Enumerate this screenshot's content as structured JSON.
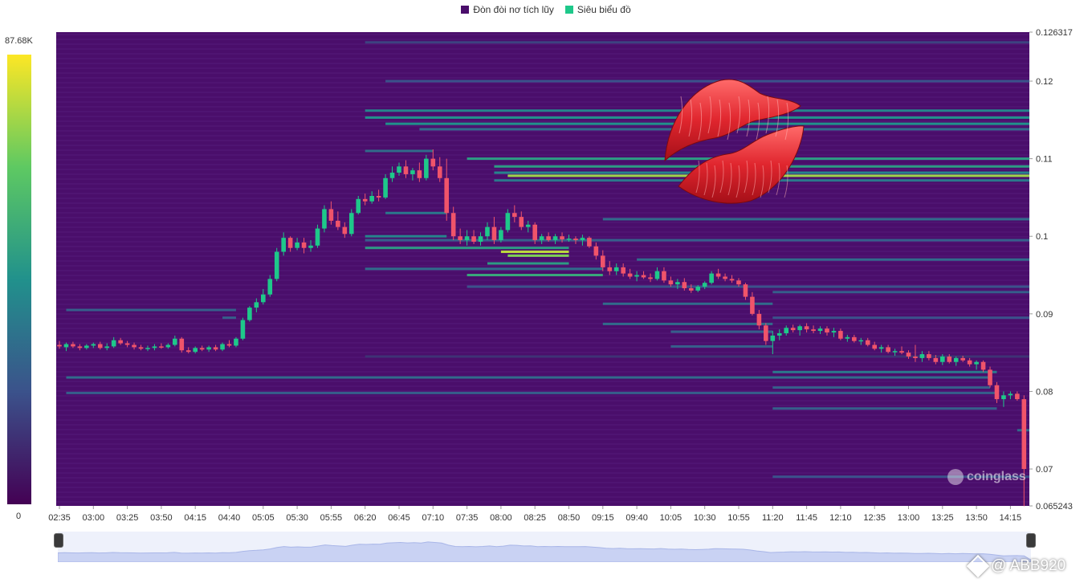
{
  "legend": [
    {
      "label": "Đòn đòi nơ tích lũy",
      "color": "#4a0e6b"
    },
    {
      "label": "Siêu biểu đồ",
      "color": "#1ec88a"
    }
  ],
  "colorbar": {
    "max_label": "87.68K",
    "min_label": "0"
  },
  "chart_data": {
    "type": "heatmap",
    "title": "",
    "xlabel": "",
    "ylabel": "",
    "ylim": [
      0.065243,
      0.126317
    ],
    "y_ticks": [
      "0.126317",
      "0.12",
      "0.11",
      "0.1",
      "0.09",
      "0.08",
      "0.07",
      "0.065243"
    ],
    "x_ticks": [
      "02:35",
      "03:00",
      "03:25",
      "03:50",
      "04:15",
      "04:40",
      "05:05",
      "05:30",
      "05:55",
      "06:20",
      "06:45",
      "07:10",
      "07:35",
      "08:00",
      "08:25",
      "08:50",
      "09:15",
      "09:40",
      "10:05",
      "10:30",
      "10:55",
      "11:20",
      "11:45",
      "12:10",
      "12:35",
      "13:00",
      "13:25",
      "13:50",
      "14:15"
    ],
    "x_start_minutes": 155,
    "x_step_minutes": 5,
    "colorscale": {
      "min": 0,
      "max": 87680
    },
    "heat_bands": [
      {
        "price": 0.1162,
        "start": "06:20",
        "end": "14:35",
        "intensity": 0.45
      },
      {
        "price": 0.1153,
        "start": "06:20",
        "end": "14:35",
        "intensity": 0.5
      },
      {
        "price": 0.1145,
        "start": "06:35",
        "end": "14:35",
        "intensity": 0.5
      },
      {
        "price": 0.1138,
        "start": "07:00",
        "end": "14:35",
        "intensity": 0.35
      },
      {
        "price": 0.111,
        "start": "06:20",
        "end": "07:10",
        "intensity": 0.35
      },
      {
        "price": 0.11,
        "start": "07:35",
        "end": "14:35",
        "intensity": 0.55
      },
      {
        "price": 0.109,
        "start": "07:55",
        "end": "14:35",
        "intensity": 0.55
      },
      {
        "price": 0.1082,
        "start": "07:55",
        "end": "14:35",
        "intensity": 0.45
      },
      {
        "price": 0.1078,
        "start": "08:05",
        "end": "14:35",
        "intensity": 0.85
      },
      {
        "price": 0.1072,
        "start": "07:55",
        "end": "14:35",
        "intensity": 0.4
      },
      {
        "price": 0.12,
        "start": "06:35",
        "end": "14:35",
        "intensity": 0.25
      },
      {
        "price": 0.125,
        "start": "06:20",
        "end": "14:35",
        "intensity": 0.2
      },
      {
        "price": 0.103,
        "start": "06:35",
        "end": "07:20",
        "intensity": 0.4
      },
      {
        "price": 0.1022,
        "start": "09:15",
        "end": "14:35",
        "intensity": 0.35
      },
      {
        "price": 0.1,
        "start": "06:20",
        "end": "07:20",
        "intensity": 0.45
      },
      {
        "price": 0.0995,
        "start": "06:20",
        "end": "14:35",
        "intensity": 0.3
      },
      {
        "price": 0.0985,
        "start": "06:20",
        "end": "08:50",
        "intensity": 0.55
      },
      {
        "price": 0.098,
        "start": "08:00",
        "end": "08:50",
        "intensity": 0.9
      },
      {
        "price": 0.0975,
        "start": "08:05",
        "end": "08:50",
        "intensity": 0.8
      },
      {
        "price": 0.097,
        "start": "09:40",
        "end": "14:35",
        "intensity": 0.35
      },
      {
        "price": 0.0965,
        "start": "07:50",
        "end": "08:50",
        "intensity": 0.55
      },
      {
        "price": 0.0958,
        "start": "06:20",
        "end": "09:15",
        "intensity": 0.35
      },
      {
        "price": 0.095,
        "start": "07:35",
        "end": "09:15",
        "intensity": 0.6
      },
      {
        "price": 0.0935,
        "start": "07:35",
        "end": "14:35",
        "intensity": 0.25
      },
      {
        "price": 0.0928,
        "start": "11:20",
        "end": "14:35",
        "intensity": 0.3
      },
      {
        "price": 0.0913,
        "start": "09:15",
        "end": "11:20",
        "intensity": 0.35
      },
      {
        "price": 0.0905,
        "start": "02:40",
        "end": "04:45",
        "intensity": 0.3
      },
      {
        "price": 0.0895,
        "start": "04:35",
        "end": "04:45",
        "intensity": 0.3
      },
      {
        "price": 0.0895,
        "start": "11:20",
        "end": "14:35",
        "intensity": 0.25
      },
      {
        "price": 0.0887,
        "start": "09:15",
        "end": "11:20",
        "intensity": 0.35
      },
      {
        "price": 0.0877,
        "start": "10:05",
        "end": "11:20",
        "intensity": 0.3
      },
      {
        "price": 0.0858,
        "start": "10:05",
        "end": "11:20",
        "intensity": 0.3
      },
      {
        "price": 0.0845,
        "start": "06:20",
        "end": "14:35",
        "intensity": 0.15
      },
      {
        "price": 0.0825,
        "start": "11:20",
        "end": "14:05",
        "intensity": 0.4
      },
      {
        "price": 0.0818,
        "start": "02:40",
        "end": "14:00",
        "intensity": 0.35
      },
      {
        "price": 0.0805,
        "start": "11:20",
        "end": "14:00",
        "intensity": 0.3
      },
      {
        "price": 0.0798,
        "start": "02:40",
        "end": "14:05",
        "intensity": 0.3
      },
      {
        "price": 0.0778,
        "start": "11:20",
        "end": "14:05",
        "intensity": 0.3
      },
      {
        "price": 0.075,
        "start": "14:20",
        "end": "14:35",
        "intensity": 0.35
      },
      {
        "price": 0.069,
        "start": "11:20",
        "end": "14:35",
        "intensity": 0.25
      }
    ],
    "candles": [
      [
        0.086,
        0.0865,
        0.0855,
        0.0858
      ],
      [
        0.0857,
        0.0863,
        0.0852,
        0.0861
      ],
      [
        0.0861,
        0.0864,
        0.0856,
        0.0858
      ],
      [
        0.0858,
        0.0861,
        0.0853,
        0.0856
      ],
      [
        0.0856,
        0.0861,
        0.0854,
        0.0859
      ],
      [
        0.0859,
        0.0863,
        0.0856,
        0.0861
      ],
      [
        0.0861,
        0.0864,
        0.0854,
        0.0856
      ],
      [
        0.0856,
        0.0862,
        0.0853,
        0.0858
      ],
      [
        0.0858,
        0.087,
        0.0856,
        0.0866
      ],
      [
        0.0866,
        0.0869,
        0.086,
        0.0862
      ],
      [
        0.0862,
        0.0865,
        0.0857,
        0.086
      ],
      [
        0.086,
        0.0863,
        0.0854,
        0.0857
      ],
      [
        0.0857,
        0.086,
        0.0853,
        0.0855
      ],
      [
        0.0855,
        0.0859,
        0.0852,
        0.0856
      ],
      [
        0.0856,
        0.0861,
        0.0853,
        0.0858
      ],
      [
        0.0858,
        0.0862,
        0.0855,
        0.0857
      ],
      [
        0.0857,
        0.0862,
        0.0855,
        0.086
      ],
      [
        0.086,
        0.0872,
        0.0858,
        0.0868
      ],
      [
        0.0868,
        0.087,
        0.085,
        0.0853
      ],
      [
        0.0853,
        0.0857,
        0.0849,
        0.0851
      ],
      [
        0.0851,
        0.0858,
        0.0849,
        0.0856
      ],
      [
        0.0856,
        0.0859,
        0.0852,
        0.0854
      ],
      [
        0.0854,
        0.0859,
        0.0851,
        0.0857
      ],
      [
        0.0857,
        0.086,
        0.0852,
        0.0854
      ],
      [
        0.0854,
        0.0863,
        0.0852,
        0.0861
      ],
      [
        0.0861,
        0.0866,
        0.0857,
        0.0859
      ],
      [
        0.0859,
        0.087,
        0.0857,
        0.0868
      ],
      [
        0.0868,
        0.0895,
        0.0866,
        0.0892
      ],
      [
        0.0892,
        0.091,
        0.089,
        0.0908
      ],
      [
        0.0908,
        0.092,
        0.0902,
        0.0915
      ],
      [
        0.0915,
        0.0932,
        0.0912,
        0.0925
      ],
      [
        0.0925,
        0.095,
        0.0922,
        0.0945
      ],
      [
        0.0945,
        0.0985,
        0.0942,
        0.098
      ],
      [
        0.098,
        0.1005,
        0.0975,
        0.0998
      ],
      [
        0.0998,
        0.1,
        0.098,
        0.0985
      ],
      [
        0.0985,
        0.0998,
        0.0982,
        0.0992
      ],
      [
        0.0992,
        0.0998,
        0.0978,
        0.0985
      ],
      [
        0.0985,
        0.0995,
        0.098,
        0.0988
      ],
      [
        0.0988,
        0.1015,
        0.0985,
        0.101
      ],
      [
        0.101,
        0.104,
        0.1005,
        0.1035
      ],
      [
        0.1035,
        0.1045,
        0.1015,
        0.102
      ],
      [
        0.102,
        0.1032,
        0.1008,
        0.1012
      ],
      [
        0.1012,
        0.1018,
        0.0998,
        0.1003
      ],
      [
        0.1003,
        0.1035,
        0.1,
        0.103
      ],
      [
        0.103,
        0.1052,
        0.1028,
        0.1048
      ],
      [
        0.1048,
        0.1055,
        0.104,
        0.1045
      ],
      [
        0.1045,
        0.1058,
        0.1042,
        0.1052
      ],
      [
        0.1052,
        0.106,
        0.1045,
        0.105
      ],
      [
        0.105,
        0.108,
        0.1048,
        0.1075
      ],
      [
        0.1075,
        0.109,
        0.107,
        0.1082
      ],
      [
        0.1082,
        0.1095,
        0.1078,
        0.109
      ],
      [
        0.109,
        0.1098,
        0.1075,
        0.108
      ],
      [
        0.108,
        0.1088,
        0.1072,
        0.1085
      ],
      [
        0.1085,
        0.1095,
        0.107,
        0.1075
      ],
      [
        0.1075,
        0.1105,
        0.1072,
        0.11
      ],
      [
        0.11,
        0.1112,
        0.1085,
        0.109
      ],
      [
        0.109,
        0.1102,
        0.107,
        0.1075
      ],
      [
        0.1075,
        0.11,
        0.102,
        0.103
      ],
      [
        0.103,
        0.1038,
        0.0995,
        0.1
      ],
      [
        0.1,
        0.101,
        0.099,
        0.0995
      ],
      [
        0.0995,
        0.1008,
        0.0988,
        0.1
      ],
      [
        0.1,
        0.1008,
        0.099,
        0.0993
      ],
      [
        0.0993,
        0.1005,
        0.0988,
        0.1
      ],
      [
        0.1,
        0.1018,
        0.0995,
        0.1012
      ],
      [
        0.1012,
        0.1025,
        0.099,
        0.0995
      ],
      [
        0.0995,
        0.1012,
        0.0992,
        0.1008
      ],
      [
        0.1008,
        0.1035,
        0.1005,
        0.103
      ],
      [
        0.103,
        0.104,
        0.1018,
        0.1025
      ],
      [
        0.1025,
        0.1032,
        0.1008,
        0.1012
      ],
      [
        0.1012,
        0.102,
        0.1005,
        0.1015
      ],
      [
        0.1015,
        0.1018,
        0.099,
        0.0995
      ],
      [
        0.0995,
        0.1003,
        0.099,
        0.1
      ],
      [
        0.1,
        0.1005,
        0.0993,
        0.0995
      ],
      [
        0.0995,
        0.1003,
        0.099,
        0.1
      ],
      [
        0.1,
        0.1005,
        0.0992,
        0.0996
      ],
      [
        0.0996,
        0.1002,
        0.0993,
        0.0997
      ],
      [
        0.0997,
        0.1,
        0.099,
        0.0995
      ],
      [
        0.0995,
        0.1002,
        0.0988,
        0.0998
      ],
      [
        0.0998,
        0.1,
        0.0985,
        0.0987
      ],
      [
        0.0987,
        0.0992,
        0.097,
        0.0975
      ],
      [
        0.0975,
        0.0982,
        0.0955,
        0.096
      ],
      [
        0.096,
        0.0968,
        0.095,
        0.0955
      ],
      [
        0.0955,
        0.0965,
        0.095,
        0.096
      ],
      [
        0.096,
        0.0965,
        0.0948,
        0.0952
      ],
      [
        0.0952,
        0.0958,
        0.0945,
        0.0948
      ],
      [
        0.0948,
        0.0955,
        0.0942,
        0.095
      ],
      [
        0.095,
        0.0955,
        0.0945,
        0.0947
      ],
      [
        0.0947,
        0.0952,
        0.0941,
        0.0945
      ],
      [
        0.0945,
        0.096,
        0.0943,
        0.0955
      ],
      [
        0.0955,
        0.096,
        0.094,
        0.0943
      ],
      [
        0.0943,
        0.0948,
        0.0935,
        0.0938
      ],
      [
        0.0938,
        0.0945,
        0.0932,
        0.0941
      ],
      [
        0.0941,
        0.0946,
        0.093,
        0.0933
      ],
      [
        0.0933,
        0.0938,
        0.0927,
        0.093
      ],
      [
        0.093,
        0.0937,
        0.0928,
        0.0935
      ],
      [
        0.0935,
        0.0942,
        0.0932,
        0.094
      ],
      [
        0.094,
        0.0955,
        0.0938,
        0.0952
      ],
      [
        0.0952,
        0.0958,
        0.0945,
        0.0948
      ],
      [
        0.0948,
        0.0952,
        0.0942,
        0.0945
      ],
      [
        0.0945,
        0.095,
        0.094,
        0.0943
      ],
      [
        0.0943,
        0.0946,
        0.0935,
        0.0938
      ],
      [
        0.0938,
        0.094,
        0.0918,
        0.0922
      ],
      [
        0.0922,
        0.0928,
        0.0898,
        0.09
      ],
      [
        0.09,
        0.0905,
        0.088,
        0.0885
      ],
      [
        0.0885,
        0.0888,
        0.086,
        0.0865
      ],
      [
        0.0865,
        0.0878,
        0.0848,
        0.0872
      ],
      [
        0.0872,
        0.088,
        0.0866,
        0.0875
      ],
      [
        0.0875,
        0.0885,
        0.0872,
        0.0882
      ],
      [
        0.0882,
        0.0886,
        0.0876,
        0.0879
      ],
      [
        0.0879,
        0.0886,
        0.0872,
        0.0884
      ],
      [
        0.0884,
        0.0888,
        0.0876,
        0.088
      ],
      [
        0.088,
        0.0885,
        0.0875,
        0.0878
      ],
      [
        0.0878,
        0.0884,
        0.0874,
        0.0881
      ],
      [
        0.0881,
        0.0884,
        0.0872,
        0.0876
      ],
      [
        0.0876,
        0.0882,
        0.087,
        0.0878
      ],
      [
        0.0878,
        0.0881,
        0.0866,
        0.0868
      ],
      [
        0.0868,
        0.0873,
        0.0864,
        0.087
      ],
      [
        0.087,
        0.0873,
        0.0863,
        0.0865
      ],
      [
        0.0865,
        0.0869,
        0.086,
        0.0866
      ],
      [
        0.0866,
        0.0869,
        0.0858,
        0.086
      ],
      [
        0.086,
        0.0864,
        0.0853,
        0.0855
      ],
      [
        0.0855,
        0.086,
        0.085,
        0.0857
      ],
      [
        0.0857,
        0.086,
        0.0849,
        0.0851
      ],
      [
        0.0851,
        0.0855,
        0.0846,
        0.0852
      ],
      [
        0.0852,
        0.0858,
        0.0848,
        0.085
      ],
      [
        0.085,
        0.0853,
        0.0842,
        0.0845
      ],
      [
        0.0845,
        0.086,
        0.0838,
        0.0843
      ],
      [
        0.0843,
        0.0852,
        0.0838,
        0.0848
      ],
      [
        0.0848,
        0.0852,
        0.084,
        0.0843
      ],
      [
        0.0843,
        0.0847,
        0.0835,
        0.0838
      ],
      [
        0.0838,
        0.0848,
        0.0834,
        0.0845
      ],
      [
        0.0845,
        0.0848,
        0.0836,
        0.0838
      ],
      [
        0.0838,
        0.0845,
        0.0833,
        0.0843
      ],
      [
        0.0843,
        0.0846,
        0.0838,
        0.084
      ],
      [
        0.084,
        0.0843,
        0.0832,
        0.0835
      ],
      [
        0.0835,
        0.084,
        0.0828,
        0.0838
      ],
      [
        0.0838,
        0.084,
        0.0825,
        0.0828
      ],
      [
        0.0828,
        0.0832,
        0.0805,
        0.0808
      ],
      [
        0.0808,
        0.0812,
        0.0785,
        0.079
      ],
      [
        0.079,
        0.08,
        0.078,
        0.0795
      ],
      [
        0.0795,
        0.08,
        0.079,
        0.0797
      ],
      [
        0.0797,
        0.08,
        0.0788,
        0.079
      ],
      [
        0.079,
        0.0795,
        0.0652,
        0.07
      ]
    ]
  },
  "watermark": {
    "brand": "coinglass"
  },
  "credit": {
    "text": "@ ABB920"
  }
}
